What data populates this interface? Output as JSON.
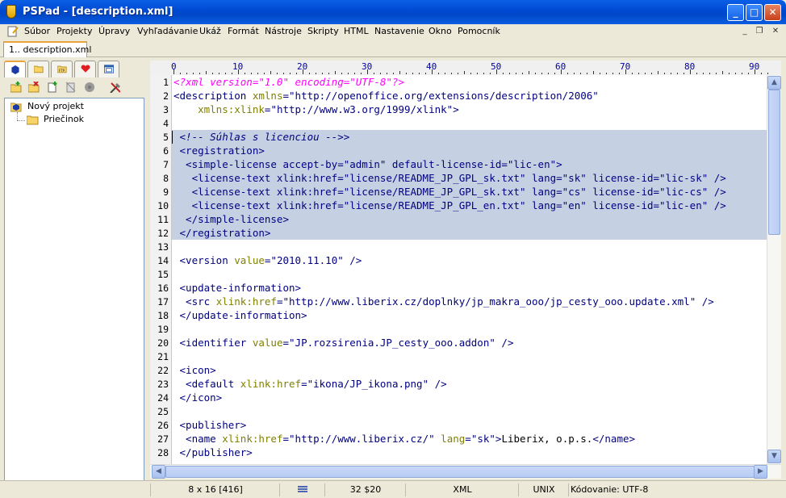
{
  "window": {
    "title": "PSPad - [description.xml]",
    "minimize": "_",
    "maximize": "□",
    "close": "✕"
  },
  "menu": [
    "Súbor",
    "Projekty",
    "Úpravy",
    "Vyhľadávanie",
    "Ukáž",
    "Formát",
    "Nástroje",
    "Skripty",
    "HTML",
    "Nastavenie",
    "Okno",
    "Pomocník"
  ],
  "doc_tab": "1.. description.xml",
  "panel_tabs": [
    "project-icon",
    "folder-icon",
    "ftp-icon",
    "favorites-heart-icon",
    "window-list-icon"
  ],
  "project_tree": {
    "project": "Nový projekt",
    "folder": "Priečinok"
  },
  "ruler_numbers": [
    "0",
    "10",
    "20",
    "30",
    "40",
    "50",
    "60",
    "70",
    "80",
    "90"
  ],
  "line_numbers": [
    "1",
    "2",
    "3",
    "4",
    "5",
    "6",
    "7",
    "8",
    "9",
    "10",
    "11",
    "12",
    "13",
    "14",
    "15",
    "16",
    "17",
    "18",
    "19",
    "20",
    "21",
    "22",
    "23",
    "24",
    "25",
    "26",
    "27",
    "28"
  ],
  "code": {
    "l1": "<?xml version=\"1.0\" encoding=\"UTF-8\"?>",
    "l2a": "<description ",
    "l2b": "xmlns",
    "l2c": "=",
    "l2d": "\"http://openoffice.org/extensions/description/2006\"",
    "l3a": "    ",
    "l3b": "xmlns:xlink",
    "l3c": "=",
    "l3d": "\"http://www.w3.org/1999/xlink\"",
    "l3e": ">",
    "l5": " <!-- Súhlas s licenciou -->>",
    "l6": " <registration>",
    "l7": "  <simple-license accept-by=\"admin\" default-license-id=\"lic-en\">",
    "l8": "   <license-text xlink:href=\"license/README_JP_GPL_sk.txt\" lang=\"sk\" license-id=\"lic-sk\" />",
    "l9": "   <license-text xlink:href=\"license/README_JP_GPL_sk.txt\" lang=\"cs\" license-id=\"lic-cs\" />",
    "l10": "   <license-text xlink:href=\"license/README_JP_GPL_en.txt\" lang=\"en\" license-id=\"lic-en\" />",
    "l11": "  </simple-license>",
    "l12": " </registration>",
    "l14a": " <version ",
    "l14b": "value",
    "l14c": "=",
    "l14d": "\"2010.11.10\"",
    "l14e": " />",
    "l16": " <update-information>",
    "l17a": "  <src ",
    "l17b": "xlink:href",
    "l17c": "=",
    "l17d": "\"http://www.liberix.cz/doplnky/jp_makra_ooo/jp_cesty_ooo.update.xml\"",
    "l17e": " />",
    "l18": " </update-information>",
    "l20a": " <identifier ",
    "l20b": "value",
    "l20c": "=",
    "l20d": "\"JP.rozsirenia.JP_cesty_ooo.addon\"",
    "l20e": " />",
    "l22": " <icon>",
    "l23a": "  <default ",
    "l23b": "xlink:href",
    "l23c": "=",
    "l23d": "\"ikona/JP_ikona.png\"",
    "l23e": " />",
    "l24": " </icon>",
    "l26": " <publisher>",
    "l27a": "  <name ",
    "l27b": "xlink:href",
    "l27c": "=",
    "l27d": "\"http://www.liberix.cz/\"",
    "l27e": " lang",
    "l27f": "=",
    "l27g": "\"sk\"",
    "l27h": ">",
    "l27i": "Liberix, o.p.s.",
    "l27j": "</name>",
    "l28": " </publisher>"
  },
  "status": {
    "position": "8 x 16 [416]",
    "code_page": "32 $20",
    "syntax": "XML",
    "line_end": "UNIX",
    "encoding": "Kódovanie: UTF-8"
  },
  "colors": {
    "titlebar": "#0054e3",
    "selection": "#c5d1e3",
    "tag": "#000080",
    "attribute": "#808000",
    "processing_instruction": "#ff00ff"
  }
}
